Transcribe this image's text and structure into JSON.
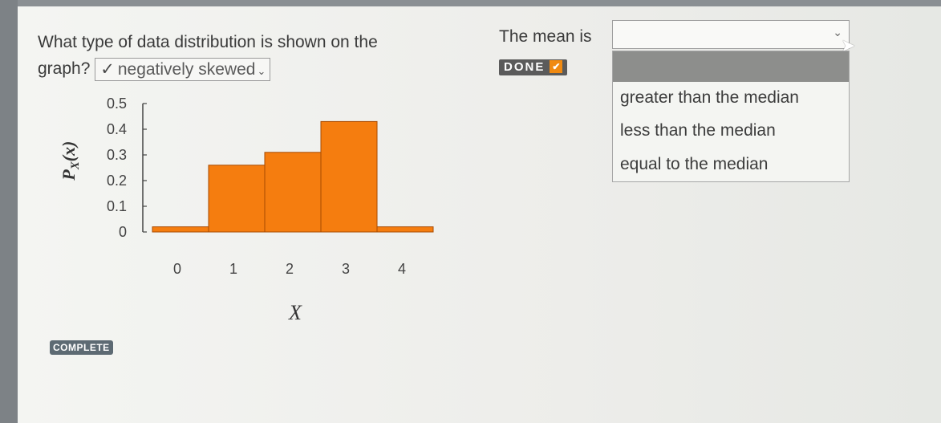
{
  "question1": {
    "text_line1": "What type of data distribution is shown on the",
    "text_line2": "graph?",
    "selected_check": "✓",
    "selected_value": "negatively skewed",
    "chevron": "⌄"
  },
  "question2": {
    "prefix": "The mean is",
    "selected_value": "",
    "chevron": "⌄",
    "options": [
      "greater than the median",
      "less than the median",
      "equal to the median"
    ]
  },
  "done_badge": {
    "label": "DONE",
    "check": "✔",
    "color": "#f08a12"
  },
  "complete_badge": {
    "label": "COMPLETE"
  },
  "colors": {
    "bar": "#f57d0f",
    "bar_edge": "#a84a00",
    "axis": "#444444"
  },
  "chart_data": {
    "type": "bar",
    "categories": [
      "0",
      "1",
      "2",
      "3",
      "4"
    ],
    "values": [
      0.02,
      0.26,
      0.31,
      0.43,
      0.02
    ],
    "xlabel": "X",
    "ylabel": "P_X(x)",
    "ylim": [
      0,
      0.5
    ],
    "yticks": [
      "0",
      "0.1",
      "0.2",
      "0.3",
      "0.4",
      "0.5"
    ],
    "grid": false
  }
}
